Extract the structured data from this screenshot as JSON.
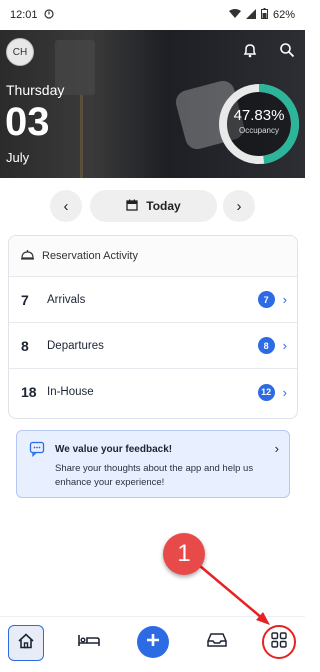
{
  "status_bar": {
    "time": "12:01",
    "battery": "62%"
  },
  "header": {
    "avatar_initials": "CH",
    "day_name": "Thursday",
    "day_number": "03",
    "month": "July",
    "occupancy_value": "47.83%",
    "occupancy_label": "Occupancy",
    "occupancy_fraction": 0.4783
  },
  "date_nav": {
    "today_label": "Today"
  },
  "reservation_activity": {
    "title": "Reservation Activity",
    "rows": [
      {
        "count": "7",
        "label": "Arrivals",
        "badge": "7"
      },
      {
        "count": "8",
        "label": "Departures",
        "badge": "8"
      },
      {
        "count": "18",
        "label": "In-House",
        "badge": "12"
      }
    ]
  },
  "feedback": {
    "title": "We value your feedback!",
    "body": "Share your thoughts about the app and help us enhance your experience!"
  },
  "annotation": {
    "marker_label": "1"
  },
  "colors": {
    "accent": "#2d6be4",
    "occupancy_ring": "#2bb59a",
    "annotation_red": "#e84a4a"
  }
}
